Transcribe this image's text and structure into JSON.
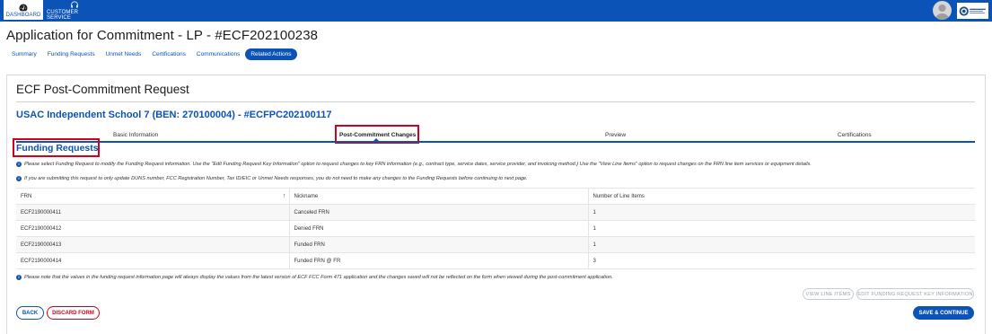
{
  "topnav": {
    "dashboard_label": "DASHBOARD",
    "customer_service_label": "CUSTOMER SERVICE"
  },
  "page": {
    "title": "Application for Commitment - LP - #ECF202100238",
    "tabs": [
      "Summary",
      "Funding Requests",
      "Unmet Needs",
      "Certifications",
      "Communications",
      "Related Actions"
    ],
    "active_tab": "Related Actions"
  },
  "card": {
    "title": "ECF Post-Commitment Request",
    "school_title": "USAC Independent School 7 (BEN: 270100004) - #ECFPC202100117"
  },
  "stepper": {
    "steps": [
      "Basic Information",
      "Post-Commitment Changes",
      "Preview",
      "Certifications"
    ],
    "active_step": "Post-Commitment Changes"
  },
  "section": {
    "title": "Funding Requests",
    "info_1": "Please select Funding Request to modify the Funding Request information. Use the \"Edit Funding Request Key Information\" option to request changes to key FRN information (e.g., contract type, service dates, service provider, and invoicing method.) Use the \"View Line Items\" option to request changes on the FRN line item services or equipment details.",
    "info_2": "If you are submitting this request to only update DUNS number, FCC Registration Number, Tax ID/EIC or Unmet Needs responses, you do not need to make any changes to the Funding Requests before continuing to next page.",
    "info_3": "Please note that the values in the funding request information page will always display the values from the latest version of ECF FCC Form 471 application and the changes saved will not be reflected on the form when viewed during the post-commitment application."
  },
  "table": {
    "headers": [
      "FRN",
      "Nickname",
      "Number of Line Items"
    ],
    "rows": [
      {
        "frn": "ECF2190000411",
        "nickname": "Canceled FRN",
        "line_items": "1"
      },
      {
        "frn": "ECF2190000412",
        "nickname": "Denied FRN",
        "line_items": "1"
      },
      {
        "frn": "ECF2190000413",
        "nickname": "Funded FRN",
        "line_items": "1"
      },
      {
        "frn": "ECF2190000414",
        "nickname": "Funded FRN @ FR",
        "line_items": "3"
      }
    ]
  },
  "buttons": {
    "view_line_items": "VIEW LINE ITEMS",
    "edit_key_info": "EDIT FUNDING REQUEST KEY INFORMATION",
    "back": "BACK",
    "discard": "DISCARD FORM",
    "save_continue": "SAVE & CONTINUE"
  },
  "colors": {
    "brand_blue": "#0c53b8",
    "highlight_red": "#d0021b"
  }
}
